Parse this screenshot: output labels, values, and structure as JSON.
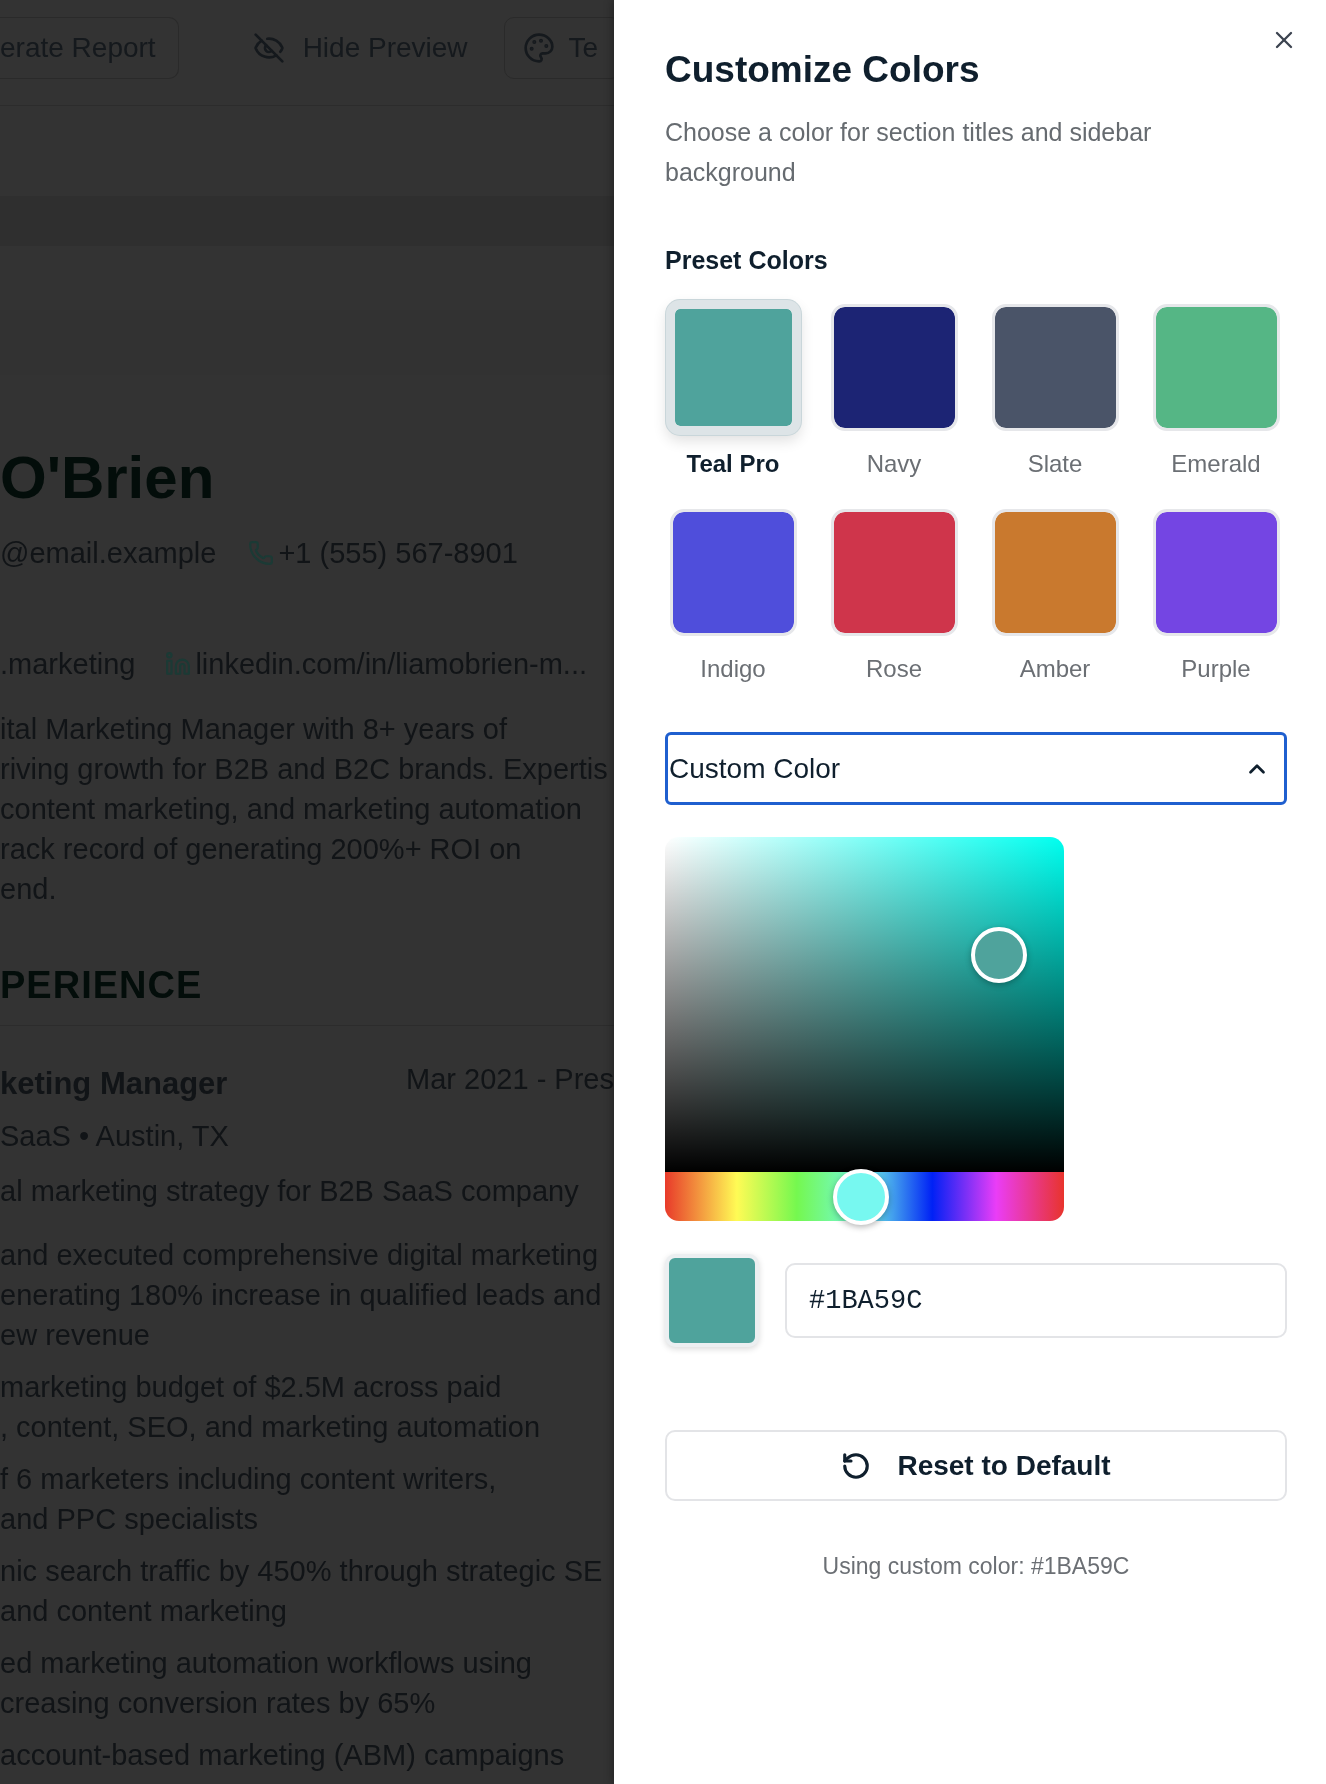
{
  "background": {
    "toolbar": [
      {
        "label": "erate Report",
        "kind": "outlined"
      },
      {
        "label": "Hide Preview",
        "kind": "plain"
      },
      {
        "label": "Te",
        "kind": "outlined"
      }
    ],
    "resume": {
      "name": "O'Brien",
      "email": "@email.example",
      "phone": "+1 (555) 567-8901",
      "website": ".marketing",
      "linkedin": "linkedin.com/in/liamobrien-m...",
      "summary": [
        "ital Marketing Manager with 8+ years of",
        "riving growth for B2B and B2C brands. Expertis",
        "content marketing, and marketing automation",
        "rack record of generating 200%+ ROI on",
        "end."
      ],
      "section_title": "PERIENCE",
      "job": {
        "title": "keting Manager",
        "dates": "Mar 2021 - Pres",
        "company": "SaaS • Austin, TX",
        "summary": "al marketing strategy for B2B SaaS company",
        "bullets": [
          {
            "lines": [
              "and executed comprehensive digital marketing",
              "enerating 180% increase in qualified leads and",
              "ew revenue"
            ]
          },
          {
            "lines": [
              "marketing budget of $2.5M across paid",
              ", content, SEO, and marketing automation"
            ]
          },
          {
            "lines": [
              "f 6 marketers including content writers,",
              "and PPC specialists"
            ]
          },
          {
            "lines": [
              "nic search traffic by 450% through strategic SE",
              "and content marketing"
            ]
          },
          {
            "lines": [
              "ed marketing automation workflows using",
              "creasing conversion rates by 65%"
            ]
          },
          {
            "lines": [
              "account-based marketing (ABM) campaigns"
            ]
          }
        ]
      }
    }
  },
  "panel": {
    "title": "Customize Colors",
    "subtitle": "Choose a color for section titles and sidebar background",
    "preset_heading": "Preset Colors",
    "presets": [
      {
        "name": "Teal Pro",
        "color": "#4fa39c",
        "selected": true
      },
      {
        "name": "Navy",
        "color": "#1c2474",
        "selected": false
      },
      {
        "name": "Slate",
        "color": "#4a5468",
        "selected": false
      },
      {
        "name": "Emerald",
        "color": "#55b685",
        "selected": false
      },
      {
        "name": "Indigo",
        "color": "#4f4edb",
        "selected": false
      },
      {
        "name": "Rose",
        "color": "#cf354b",
        "selected": false
      },
      {
        "name": "Amber",
        "color": "#c9792e",
        "selected": false
      },
      {
        "name": "Purple",
        "color": "#7445e3",
        "selected": false
      }
    ],
    "custom": {
      "label": "Custom Color",
      "expanded": true,
      "hex": "#1BA59C",
      "hue_slider": {
        "level": 0.49
      }
    },
    "reset_button": "Reset to Default",
    "caption": "Using custom color: #1BA59C"
  }
}
